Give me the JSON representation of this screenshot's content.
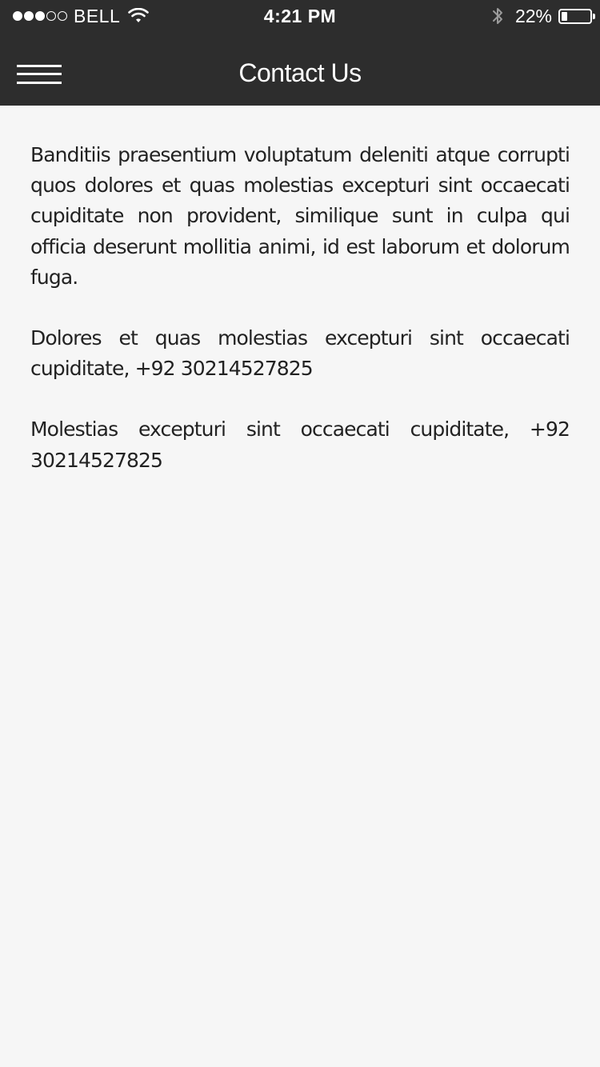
{
  "status_bar": {
    "carrier": "BELL",
    "time": "4:21 PM",
    "battery_percent": "22%",
    "battery_level": 0.22,
    "signal_bars_filled": 3,
    "signal_bars_total": 5,
    "icons": [
      "signal-dots",
      "wifi-icon",
      "bluetooth-icon",
      "battery-icon"
    ]
  },
  "nav": {
    "title": "Contact Us",
    "menu_icon": "hamburger-menu-icon"
  },
  "content": {
    "paragraphs": [
      "Banditiis praesentium voluptatum deleniti atque corrupti quos dolores et quas molestias excepturi sint occaecati cupiditate non provident, similique sunt in culpa qui officia deserunt mollitia animi, id est laborum et dolorum fuga.",
      "Dolores et quas molestias excepturi sint occaecati cupiditate, +92 30214527825",
      "Molestias excepturi sint occaecati cupiditate, +92 30214527825"
    ]
  },
  "colors": {
    "bar_background": "#2d2d2d",
    "page_background": "#f6f6f6",
    "text": "#222222",
    "bar_text": "#ffffff",
    "bluetooth_icon": "#9a9a9a"
  }
}
